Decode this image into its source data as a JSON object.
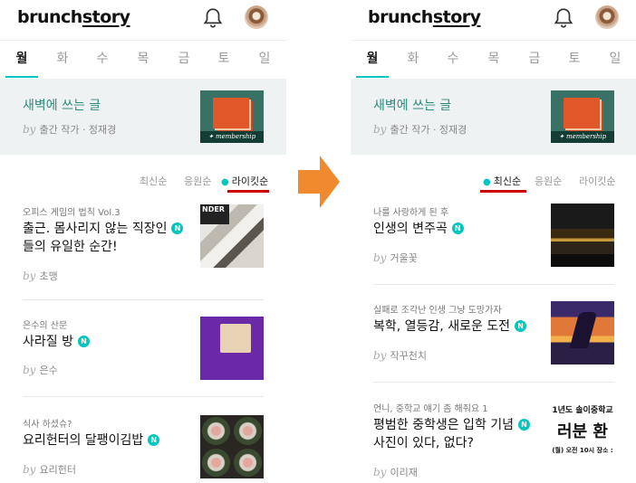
{
  "colors": {
    "accent": "#00c6be",
    "magazine_title": "#2d8b7c",
    "arrow": "#f08a2e",
    "highlight": "#cc0000"
  },
  "logo": {
    "text_a": "brunch",
    "text_b": "story"
  },
  "days": [
    "월",
    "화",
    "수",
    "목",
    "금",
    "토",
    "일"
  ],
  "magazine": {
    "title": "새벽에 쓰는 글",
    "by": "by",
    "author": "출간 작가 · 정재경",
    "badge": "membership"
  },
  "left": {
    "sort": [
      "최신순",
      "응원순",
      "라이킷순"
    ],
    "articles": [
      {
        "magazine": "오피스 게임의 법칙 Vol.3",
        "title_line1": "출근. 몸사리지 않는 직장인",
        "title_line2": "들의 유일한 순간!",
        "author": "초맹"
      },
      {
        "magazine": "은수의 산문",
        "title_line1": "사라질 방",
        "title_line2": "",
        "author": "은수"
      },
      {
        "magazine": "식사 하셨슈?",
        "title_line1": "요리헌터의 달팽이김밥",
        "title_line2": "",
        "author": "요리헌터"
      }
    ],
    "thumb1_text": "NDER"
  },
  "right": {
    "sort": [
      "최신순",
      "응원순",
      "라이킷순"
    ],
    "articles": [
      {
        "magazine": "나를 사랑하게 된 후",
        "title_line1": "인생의 변주곡",
        "title_line2": "",
        "author": "거울꽃"
      },
      {
        "magazine": "실패로 조각난 인생 그냥 도망가자",
        "title_line1": "복학, 열등감, 새로운 도전",
        "title_line2": "",
        "author": "작꾸천치"
      },
      {
        "magazine": "언니, 중학교 얘기 좀 해줘요 1",
        "title_line1": "평범한 중학생은 입학 기념",
        "title_line2": "사진이 있다, 없다?",
        "author": "이리재"
      }
    ],
    "poster": {
      "line1": "1년도 솔이중학교",
      "line2": "러분 환",
      "line3": "(월) 오전 10시 장소 :"
    }
  },
  "n_badge": "N"
}
